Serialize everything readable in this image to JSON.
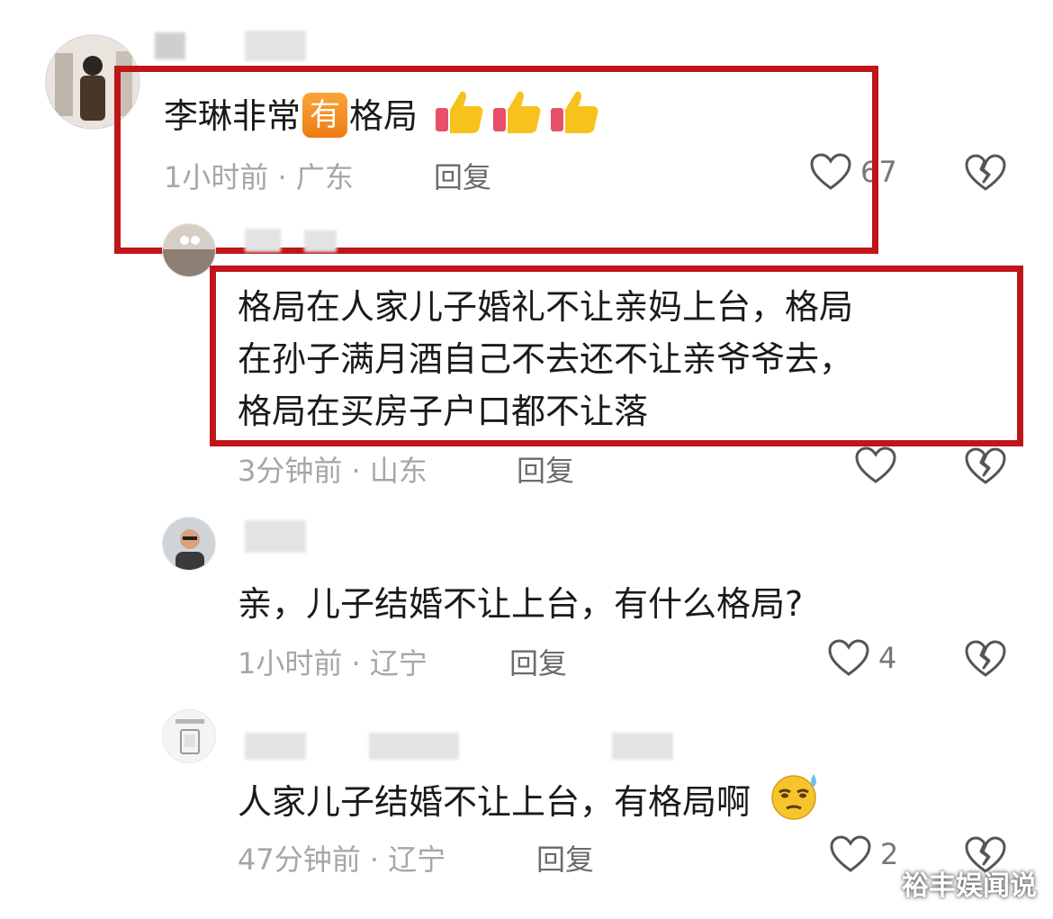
{
  "comments": [
    {
      "text_before": "李琳非常",
      "badge": "有",
      "text_after": "格局",
      "emoji": "thumbs-up-icon",
      "time": "1小时前",
      "location": "广东",
      "reply": "回复",
      "likes": "67"
    },
    {
      "lines": [
        "格局在人家儿子婚礼不让亲妈上台，格局",
        "在孙子满月酒自己不去还不让亲爷爷去，",
        "格局在买房子户口都不让落"
      ],
      "time": "3分钟前",
      "location": "山东",
      "reply": "回复",
      "likes": ""
    },
    {
      "text": "亲，儿子结婚不让上台，有什么格局?",
      "time": "1小时前",
      "location": "辽宁",
      "reply": "回复",
      "likes": "4"
    },
    {
      "text": "人家儿子结婚不让上台，有格局啊",
      "emoji": "sweat-smile-emoji",
      "time": "47分钟前",
      "location": "辽宁",
      "reply": "回复",
      "likes": "2"
    }
  ],
  "separator": "·",
  "watermark": "裕丰娱闻说",
  "colors": {
    "highlight": "#c0151a",
    "badge": "#f08a1e"
  }
}
